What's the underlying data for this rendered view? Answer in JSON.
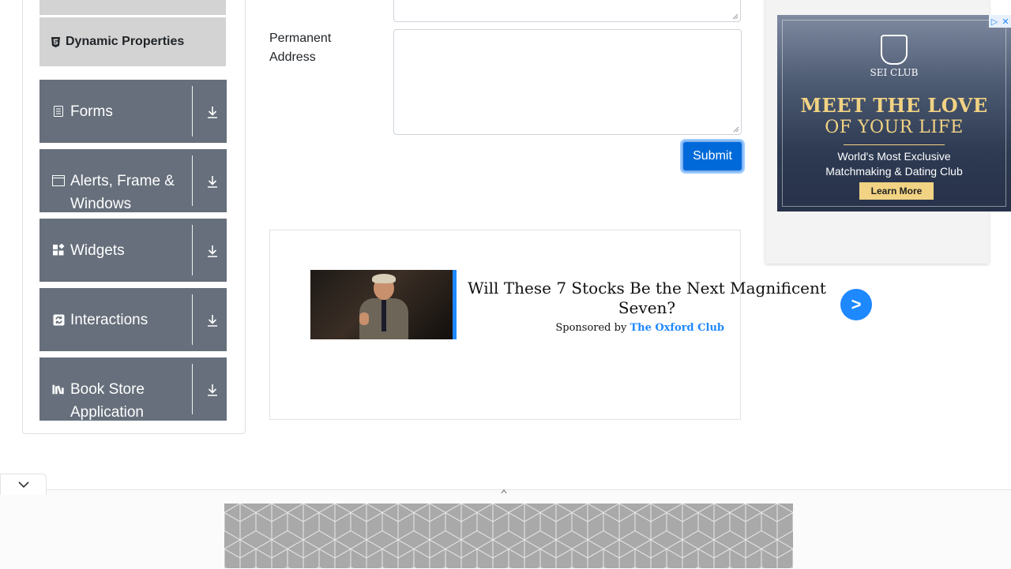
{
  "sidebar": {
    "active_item": {
      "label": "Dynamic Properties",
      "icon": "html5-icon"
    },
    "groups": [
      {
        "label": "Forms",
        "icon": "form-icon"
      },
      {
        "label": "Alerts, Frame &",
        "label2": "Windows",
        "icon": "window-icon"
      },
      {
        "label": "Widgets",
        "icon": "widgets-icon"
      },
      {
        "label": "Interactions",
        "icon": "interactions-icon"
      },
      {
        "label": "Book Store",
        "label2": "Application",
        "icon": "books-icon"
      }
    ]
  },
  "form": {
    "permanent_address_label_1": "Permanent",
    "permanent_address_label_2": "Address",
    "permanent_address_value": "",
    "submit_label": "Submit"
  },
  "sponsored": {
    "title": "Will These 7 Stocks Be the Next Magnificent Seven?",
    "sponsor_prefix": "Sponsored by",
    "sponsor_name": "The Oxford Club",
    "arrow": ">"
  },
  "right_ad": {
    "brand": "SEI CLUB",
    "headline_1": "MEET THE LOVE",
    "headline_2": "OF YOUR LIFE",
    "body_1": "World's Most Exclusive",
    "body_2": "Matchmaking & Dating Club",
    "cta": "Learn More"
  },
  "colors": {
    "sidebar_group_bg": "#666f7b",
    "sidebar_active_bg": "#d3d3d3",
    "submit_bg": "#0069d9",
    "sponsor_accent": "#1e88ff",
    "ad_gold": "#f2d383"
  }
}
